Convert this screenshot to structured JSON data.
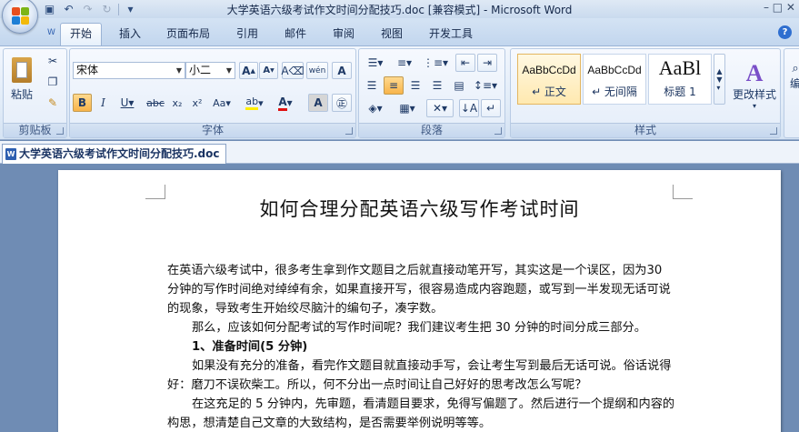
{
  "window": {
    "title": "大学英语六级考试作文时间分配技巧.doc [兼容模式] - Microsoft Word",
    "controls": "–  □  ✕"
  },
  "qat": [
    "save-icon",
    "undo-icon",
    "redo-icon",
    "customize-icon"
  ],
  "tabs": [
    {
      "label": "开始",
      "active": true
    },
    {
      "label": "插入"
    },
    {
      "label": "页面布局"
    },
    {
      "label": "引用"
    },
    {
      "label": "邮件"
    },
    {
      "label": "审阅"
    },
    {
      "label": "视图"
    },
    {
      "label": "开发工具"
    }
  ],
  "ribbon": {
    "clipboard": {
      "label": "剪贴板",
      "paste": "粘贴"
    },
    "font": {
      "label": "字体",
      "font_name": "宋体",
      "font_size": "小二"
    },
    "paragraph": {
      "label": "段落"
    },
    "styles": {
      "label": "样式",
      "items": [
        {
          "sample": "AaBbCcDd",
          "name": "↵ 正文"
        },
        {
          "sample": "AaBbCcDd",
          "name": "↵ 无间隔"
        },
        {
          "sample": "AaBl",
          "name": "标题 1"
        }
      ],
      "change_styles": "更改样式"
    },
    "editing": {
      "label": "编"
    }
  },
  "document": {
    "tab": "大学英语六级考试作文时间分配技巧.doc",
    "title": "如何合理分配英语六级写作考试时间",
    "paragraphs": [
      "在英语六级考试中，很多考生拿到作文题目之后就直接动笔开写，其实这是一个误区，因为30 分钟的写作时间绝对绰绰有余，如果直接开写，很容易造成内容跑题，或写到一半发现无话可说的现象，导致考生开始绞尽脑汁的编句子，凑字数。",
      "那么，应该如何分配考试的写作时间呢？我们建议考生把 30 分钟的时间分成三部分。",
      "1、准备时间(5 分钟)",
      "如果没有充分的准备，看完作文题目就直接动手写，会让考生写到最后无话可说。俗话说得好：磨刀不误砍柴工。所以，何不分出一点时间让自己好好的思考改怎么写呢？",
      "在这充足的 5 分钟内，先审题，看清题目要求，免得写偏题了。然后进行一个提纲和内容的构思，想清楚自己文章的大致结构，是否需要举例说明等等。"
    ]
  }
}
